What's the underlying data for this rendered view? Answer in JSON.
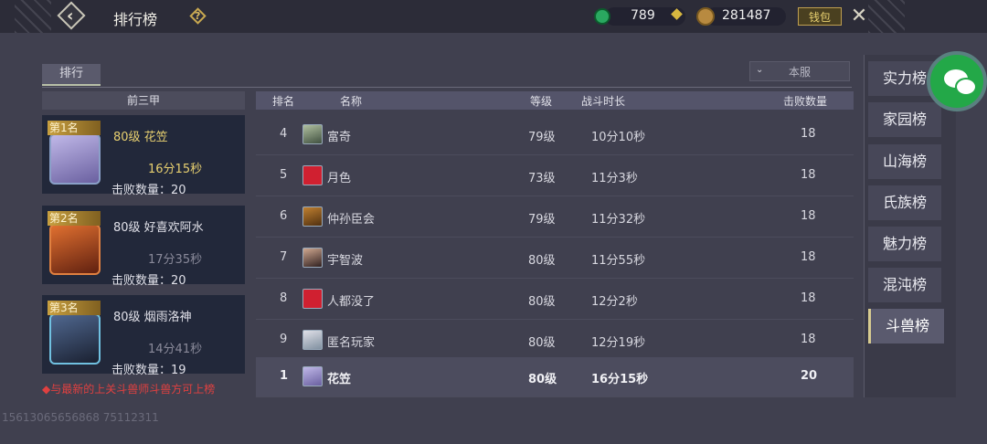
{
  "header": {
    "title": "排行榜",
    "help_icon": "help-icon",
    "jade_value": "789",
    "coin_value": "281487",
    "wallet_label": "钱包"
  },
  "tabs": {
    "rank": "排行"
  },
  "server": {
    "selected": "本服"
  },
  "top3": {
    "header": "前三甲",
    "cards": [
      {
        "badge": "第1名",
        "level_name": "80级  花笠",
        "time": "16分15秒",
        "kills": "击败数量：20"
      },
      {
        "badge": "第2名",
        "level_name": "80级  好喜欢阿水",
        "time": "17分35秒",
        "kills": "击败数量：20"
      },
      {
        "badge": "第3名",
        "level_name": "80级  烟雨洛神",
        "time": "14分41秒",
        "kills": "击败数量：19"
      }
    ]
  },
  "notice": "◆与最新的上关斗兽师斗兽方可上榜",
  "id_text": "15613065656868 75112311",
  "table": {
    "columns": [
      "排名",
      "名称",
      "等级",
      "战斗时长",
      "击败数量"
    ],
    "rows": [
      {
        "rank": "4",
        "name": "富奇",
        "level": "79级",
        "time": "10分10秒",
        "kills": "18"
      },
      {
        "rank": "5",
        "name": "月色",
        "level": "73级",
        "time": "11分3秒",
        "kills": "18"
      },
      {
        "rank": "6",
        "name": "仲孙臣会",
        "level": "79级",
        "time": "11分32秒",
        "kills": "18"
      },
      {
        "rank": "7",
        "name": "宇智波",
        "level": "80级",
        "time": "11分55秒",
        "kills": "18"
      },
      {
        "rank": "8",
        "name": "人都没了",
        "level": "80级",
        "time": "12分2秒",
        "kills": "18"
      },
      {
        "rank": "9",
        "name": "匿名玩家",
        "level": "80级",
        "time": "12分19秒",
        "kills": "18"
      }
    ],
    "my_row": {
      "rank": "1",
      "name": "花笠",
      "level": "80级",
      "time": "16分15秒",
      "kills": "20"
    }
  },
  "sidebar": {
    "items": [
      {
        "label": "实力榜"
      },
      {
        "label": "家园榜"
      },
      {
        "label": "山海榜"
      },
      {
        "label": "氏族榜"
      },
      {
        "label": "魅力榜"
      },
      {
        "label": "混沌榜"
      },
      {
        "label": "斗兽榜"
      }
    ],
    "active_index": 6
  }
}
